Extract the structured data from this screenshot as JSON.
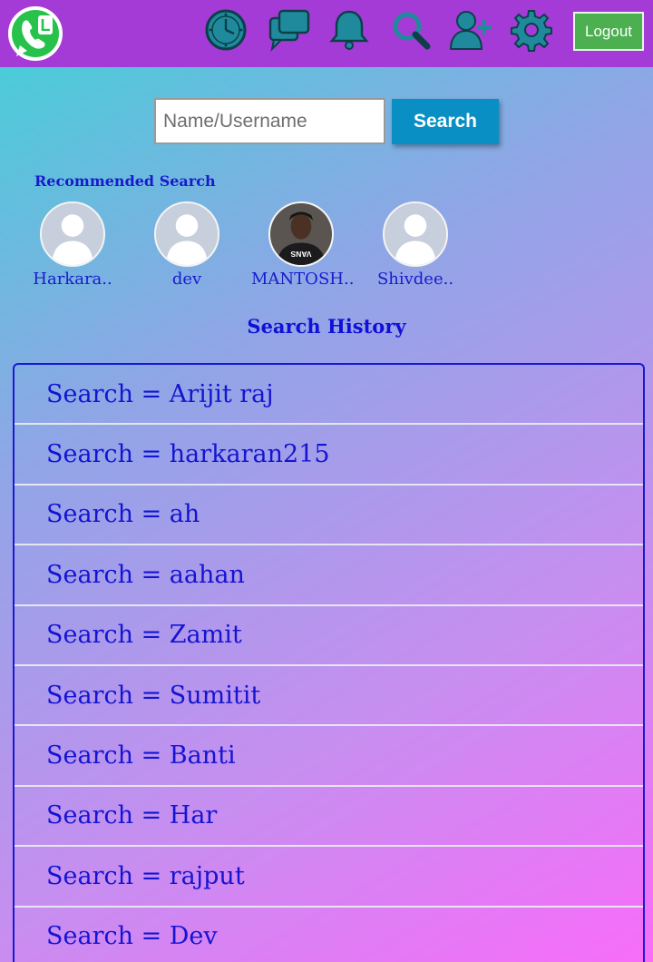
{
  "header": {
    "logo_letter": "L",
    "logout_label": "Logout",
    "nav_icons": [
      "clock-icon",
      "chat-icon",
      "bell-icon",
      "search-icon",
      "add-user-icon",
      "gear-icon"
    ]
  },
  "search": {
    "placeholder": "Name/Username",
    "value": "",
    "button_label": "Search"
  },
  "recommended": {
    "title": "Recommended Search",
    "users": [
      {
        "name": "Harkara..",
        "avatar": "default"
      },
      {
        "name": "dev",
        "avatar": "default"
      },
      {
        "name": "MANTOSH..",
        "avatar": "photo",
        "shirt_text": "VANS"
      },
      {
        "name": "Shivdee..",
        "avatar": "default"
      }
    ]
  },
  "history": {
    "title": "Search History",
    "items": [
      "Search = Arijit raj",
      "Search = harkaran215",
      "Search = ah",
      "Search = aahan",
      "Search = Zamit",
      "Search = Sumitit",
      "Search = Banti",
      "Search = Har",
      "Search = rajput",
      "Search = Dev"
    ]
  },
  "colors": {
    "header_bg": "#a53bd6",
    "icon_teal": "#1f8a9c",
    "link_blue": "#1414d2",
    "search_button": "#0a8fc4",
    "logout_button": "#4caf50"
  }
}
